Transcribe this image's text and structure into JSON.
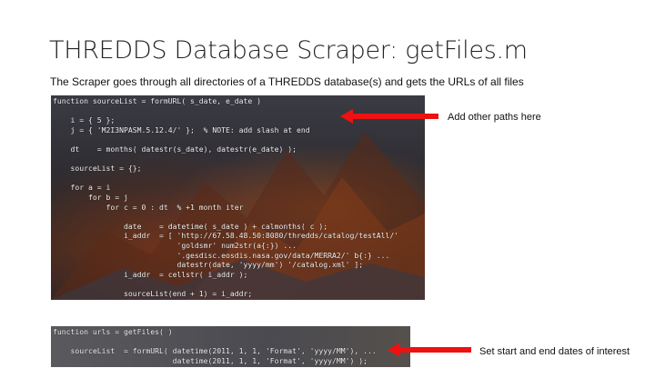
{
  "slide": {
    "title": "THREDDS Database Scraper: getFiles.m",
    "subtitle": "The Scraper goes through all directories of a THREDDS database(s) and gets the URLs of all files"
  },
  "code_block_1": {
    "lines": [
      "function sourceList = formURL( s_date, e_date )",
      "",
      "    i = { 5 };",
      "    j = { 'M2I3NPASM.5.12.4/' };  % NOTE: add slash at end",
      "",
      "    dt    = months( datestr(s_date), datestr(e_date) );",
      "",
      "    sourceList = {};",
      "",
      "    for a = i",
      "        for b = j",
      "            for c = 0 : dt  % +1 month iter",
      "",
      "                date    = datetime( s_date ) + calmonths( c );",
      "                i_addr  = [ 'http://67.58.48.50:8080/thredds/catalog/testAll/'",
      "                            'goldsmr' num2str(a{:}) ...",
      "                            '.gesdisc.eosdis.nasa.gov/data/MERRA2/' b{:} ...",
      "                            datestr(date, 'yyyy/mm') '/catalog.xml' ];",
      "                i_addr  = cellstr( i_addr );",
      "",
      "                sourceList(end + 1) = i_addr;"
    ]
  },
  "code_block_2": {
    "lines": [
      "function urls = getFiles( )",
      "",
      "    sourceList  = formURL( datetime(2011, 1, 1, 'Format', 'yyyy/MM'), ...",
      "                           datetime(2011, 1, 1, 'Format', 'yyyy/MM') );"
    ]
  },
  "annotations": {
    "paths": "Add other paths here",
    "dates": "Set start and end dates of interest"
  },
  "colors": {
    "arrow": "#ee1111",
    "code_text": "#f2f2f2",
    "title_text": "#222222"
  },
  "icons": {
    "arrow_1": "left-arrow-icon",
    "arrow_2": "left-arrow-icon"
  }
}
